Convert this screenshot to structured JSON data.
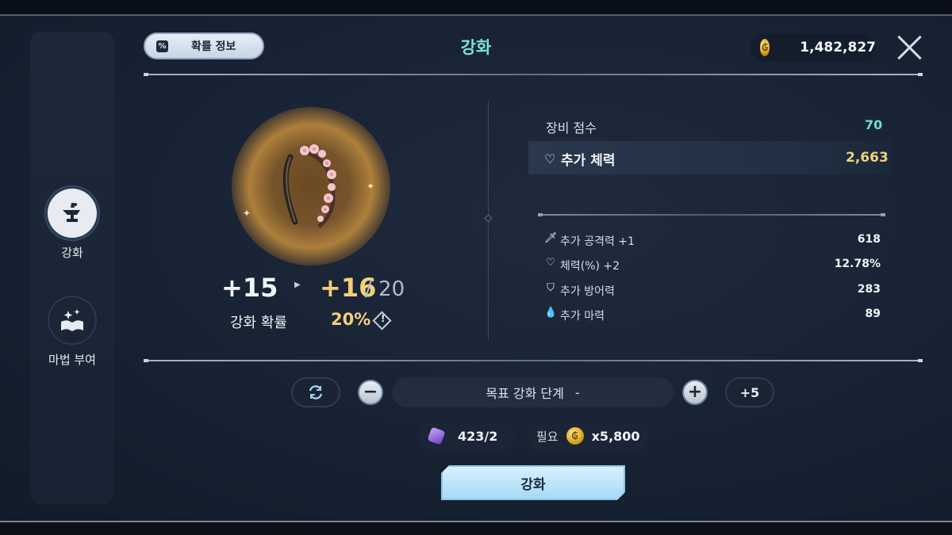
{
  "header": {
    "probability_button": "확률 정보",
    "title": "강화",
    "gold": "1,482,827"
  },
  "sidebar": {
    "items": [
      {
        "label": "강화",
        "icon": "anvil-icon",
        "active": true
      },
      {
        "label": "마법 부여",
        "icon": "spellbook-icon",
        "active": false
      }
    ]
  },
  "enhance": {
    "current_level": "+15",
    "next_level": "+16",
    "max_level": "/ 20",
    "rate_label": "강화 확률",
    "rate_value": "20%",
    "info_glyph": "!"
  },
  "stats": {
    "score_label": "장비 점수",
    "score_value": "70",
    "highlight": {
      "icon": "heart-icon",
      "label": "추가 체력",
      "value": "2,663"
    },
    "sub": [
      {
        "icon": "sword-icon",
        "label": "추가 공격력 +1",
        "value": "618"
      },
      {
        "icon": "heart-icon",
        "label": "체력(%) +2",
        "value": "12.78%"
      },
      {
        "icon": "shield-icon",
        "label": "추가 방어력",
        "value": "283"
      },
      {
        "icon": "drop-icon",
        "label": "추가 마력",
        "value": "89"
      }
    ]
  },
  "controls": {
    "target_label": "목표 강화 단계",
    "target_value": "-",
    "plus5": "+5",
    "minus": "−",
    "plus": "+"
  },
  "cost": {
    "stones": "423/2",
    "need_label": "필요",
    "gold_cost": "x5,800"
  },
  "action": {
    "enhance_button": "강화"
  },
  "colors": {
    "title": "#7de3cf",
    "gold_text": "#f2cf7a",
    "button_light": "#a6d9f5"
  }
}
